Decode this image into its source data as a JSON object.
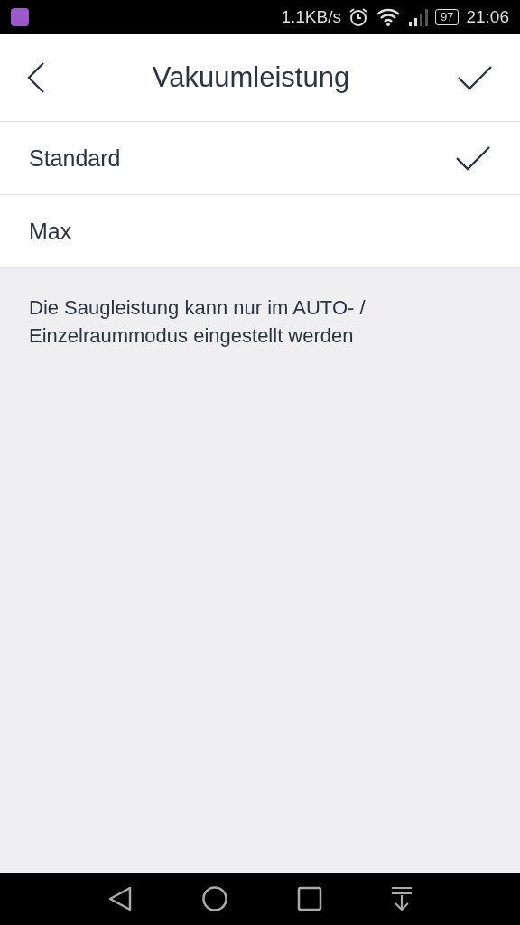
{
  "status_bar": {
    "speed": "1.1KB/s",
    "battery": "97",
    "time": "21:06"
  },
  "header": {
    "title": "Vakuumleistung"
  },
  "options": [
    {
      "label": "Standard",
      "selected": true
    },
    {
      "label": "Max",
      "selected": false
    }
  ],
  "note": "Die Saugleistung kann nur im AUTO- / Einzelraummodus eingestellt werden"
}
